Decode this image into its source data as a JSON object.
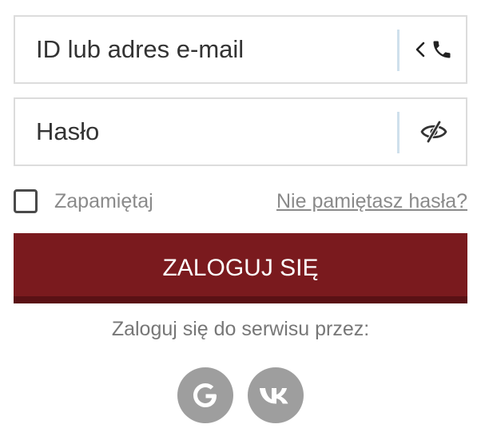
{
  "login": {
    "placeholder": "ID lub adres e-mail",
    "value": "",
    "icons": [
      "chevron-left-icon",
      "phone-icon"
    ]
  },
  "password": {
    "placeholder": "Hasło",
    "value": "",
    "icon": "eye-slash-icon"
  },
  "remember": {
    "label": "Zapamiętaj",
    "checked": false
  },
  "forgot": {
    "label": "Nie pamiętasz hasła?"
  },
  "submit": {
    "label": "ZALOGUJ SIĘ"
  },
  "social": {
    "caption": "Zaloguj się do serwisu przez:",
    "providers": [
      {
        "name": "google",
        "icon": "google-icon",
        "glyph": "G"
      },
      {
        "name": "vk",
        "icon": "vk-icon",
        "glyph": "VK"
      }
    ]
  },
  "colors": {
    "accent": "#7a1a1e",
    "border": "#dcdcdc",
    "separator": "#cfe0ec",
    "icon_gray": "#9e9e9e",
    "muted_text": "#8a8a8a"
  }
}
